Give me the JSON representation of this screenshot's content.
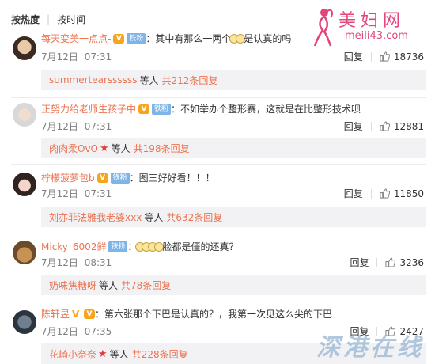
{
  "sort": {
    "hot": "按热度",
    "time": "按时间"
  },
  "watermark": {
    "site_name": "美妇网",
    "site_url": "meili43.com",
    "bottom_text": "深港在线"
  },
  "comments": [
    {
      "user": "每天变美一点点-",
      "badge": "铁粉",
      "text": "：其中有那么一两个",
      "text_after": "是认真的吗",
      "date": "7月12日",
      "time": "07:31",
      "reply_label": "回复",
      "likes": "18736",
      "sub": {
        "name": "summertearssssss",
        "etc": "等人",
        "count": "共212条回复"
      }
    },
    {
      "user": "正努力给老师生孩子中",
      "badge": "铁粉",
      "text": "：不如举办个整形赛，这就是在比整形技术呗",
      "date": "7月12日",
      "time": "07:31",
      "reply_label": "回复",
      "likes": "12881",
      "sub": {
        "name": "肉肉柔OvO",
        "etc": "等人",
        "count": "共198条回复"
      }
    },
    {
      "user": "柠檬菠萝包b",
      "badge": "铁粉",
      "text": "：图三好好看！！！",
      "date": "7月12日",
      "time": "07:31",
      "reply_label": "回复",
      "likes": "11850",
      "sub": {
        "name": "刘亦菲法雅我老婆xxx",
        "etc": "等人",
        "count": "共632条回复"
      }
    },
    {
      "user": "Micky_6002鲜",
      "badge": "铁粉",
      "text": "：",
      "text_after": "脸都是僵的还真？",
      "date": "7月12日",
      "time": "08:31",
      "reply_label": "回复",
      "likes": "3236",
      "sub": {
        "name": "奶味焦糖呀",
        "etc": "等人",
        "count": "共78条回复"
      }
    },
    {
      "user": "陈轩昱",
      "text": "：第六张那个下巴是认真的？，我第一次见这么尖的下巴",
      "date": "7月12日",
      "time": "07:35",
      "reply_label": "回复",
      "likes": "2427",
      "sub": {
        "name": "花崎小奈奈",
        "etc": "等人",
        "count": "共228条回复"
      }
    }
  ]
}
